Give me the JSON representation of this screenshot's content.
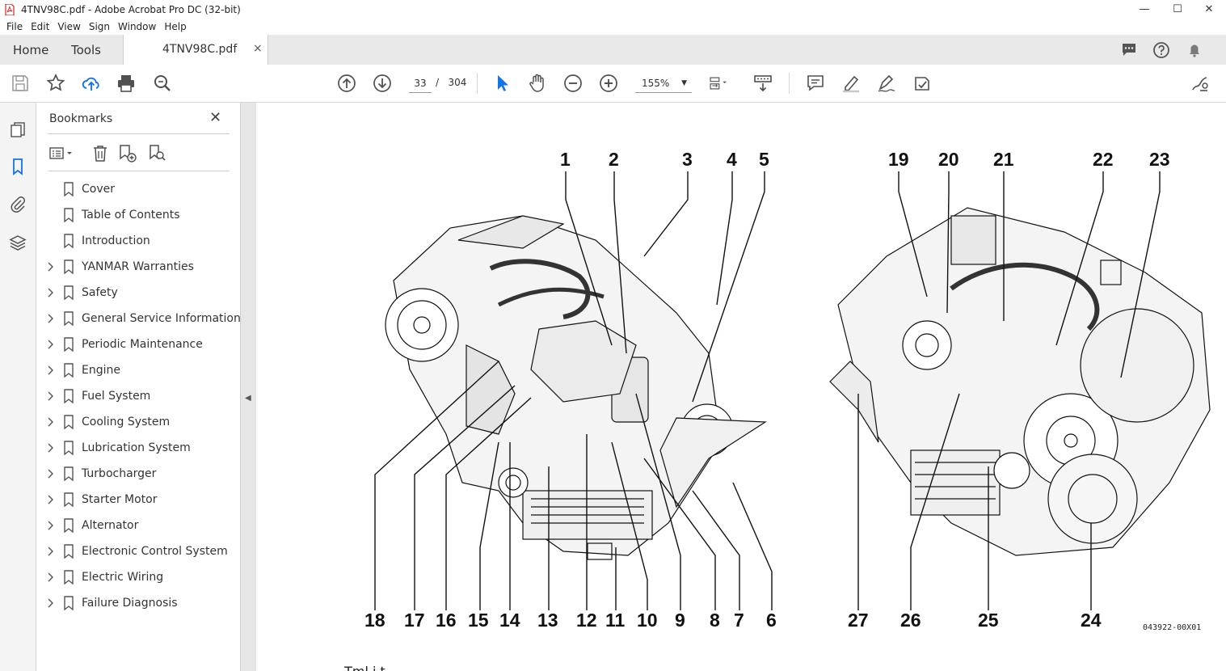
{
  "window": {
    "title": "4TNV98C.pdf - Adobe Acrobat Pro DC (32-bit)",
    "minimize": "—",
    "maximize": "☐",
    "close": "✕"
  },
  "menu": [
    "File",
    "Edit",
    "View",
    "Sign",
    "Window",
    "Help"
  ],
  "tabs": {
    "home": "Home",
    "tools": "Tools",
    "document": "4TNV98C.pdf",
    "close_symbol": "×"
  },
  "toolbar": {
    "current_page": "33",
    "page_separator": "/",
    "total_pages": "304",
    "zoom": "155%"
  },
  "bookmarks_panel": {
    "title": "Bookmarks",
    "items": [
      {
        "label": "Cover",
        "expandable": false
      },
      {
        "label": "Table of Contents",
        "expandable": false
      },
      {
        "label": "Introduction",
        "expandable": false
      },
      {
        "label": "YANMAR Warranties",
        "expandable": true
      },
      {
        "label": "Safety",
        "expandable": true
      },
      {
        "label": "General Service Information",
        "expandable": true
      },
      {
        "label": "Periodic Maintenance",
        "expandable": true
      },
      {
        "label": "Engine",
        "expandable": true
      },
      {
        "label": "Fuel System",
        "expandable": true
      },
      {
        "label": "Cooling System",
        "expandable": true
      },
      {
        "label": "Lubrication System",
        "expandable": true
      },
      {
        "label": "Turbocharger",
        "expandable": true
      },
      {
        "label": "Starter Motor",
        "expandable": true
      },
      {
        "label": "Alternator",
        "expandable": true
      },
      {
        "label": "Electronic Control System",
        "expandable": true
      },
      {
        "label": "Electric Wiring",
        "expandable": true
      },
      {
        "label": "Failure Diagnosis",
        "expandable": true
      }
    ]
  },
  "document": {
    "figure_code": "043922-00X01",
    "cutoff_text": "– Tml i t",
    "callouts_top_left": [
      "1",
      "2",
      "3",
      "4",
      "5"
    ],
    "callouts_top_right": [
      "19",
      "20",
      "21",
      "22",
      "23"
    ],
    "callouts_bottom_left": [
      "18",
      "17",
      "16",
      "15",
      "14",
      "13",
      "12",
      "11",
      "10",
      "9",
      "8",
      "7",
      "6"
    ],
    "callouts_bottom_right": [
      "27",
      "26",
      "25",
      "24"
    ]
  },
  "colors": {
    "acrobat_red": "#d7261e",
    "accent_blue": "#1473e6",
    "icon_gray": "#505050"
  }
}
